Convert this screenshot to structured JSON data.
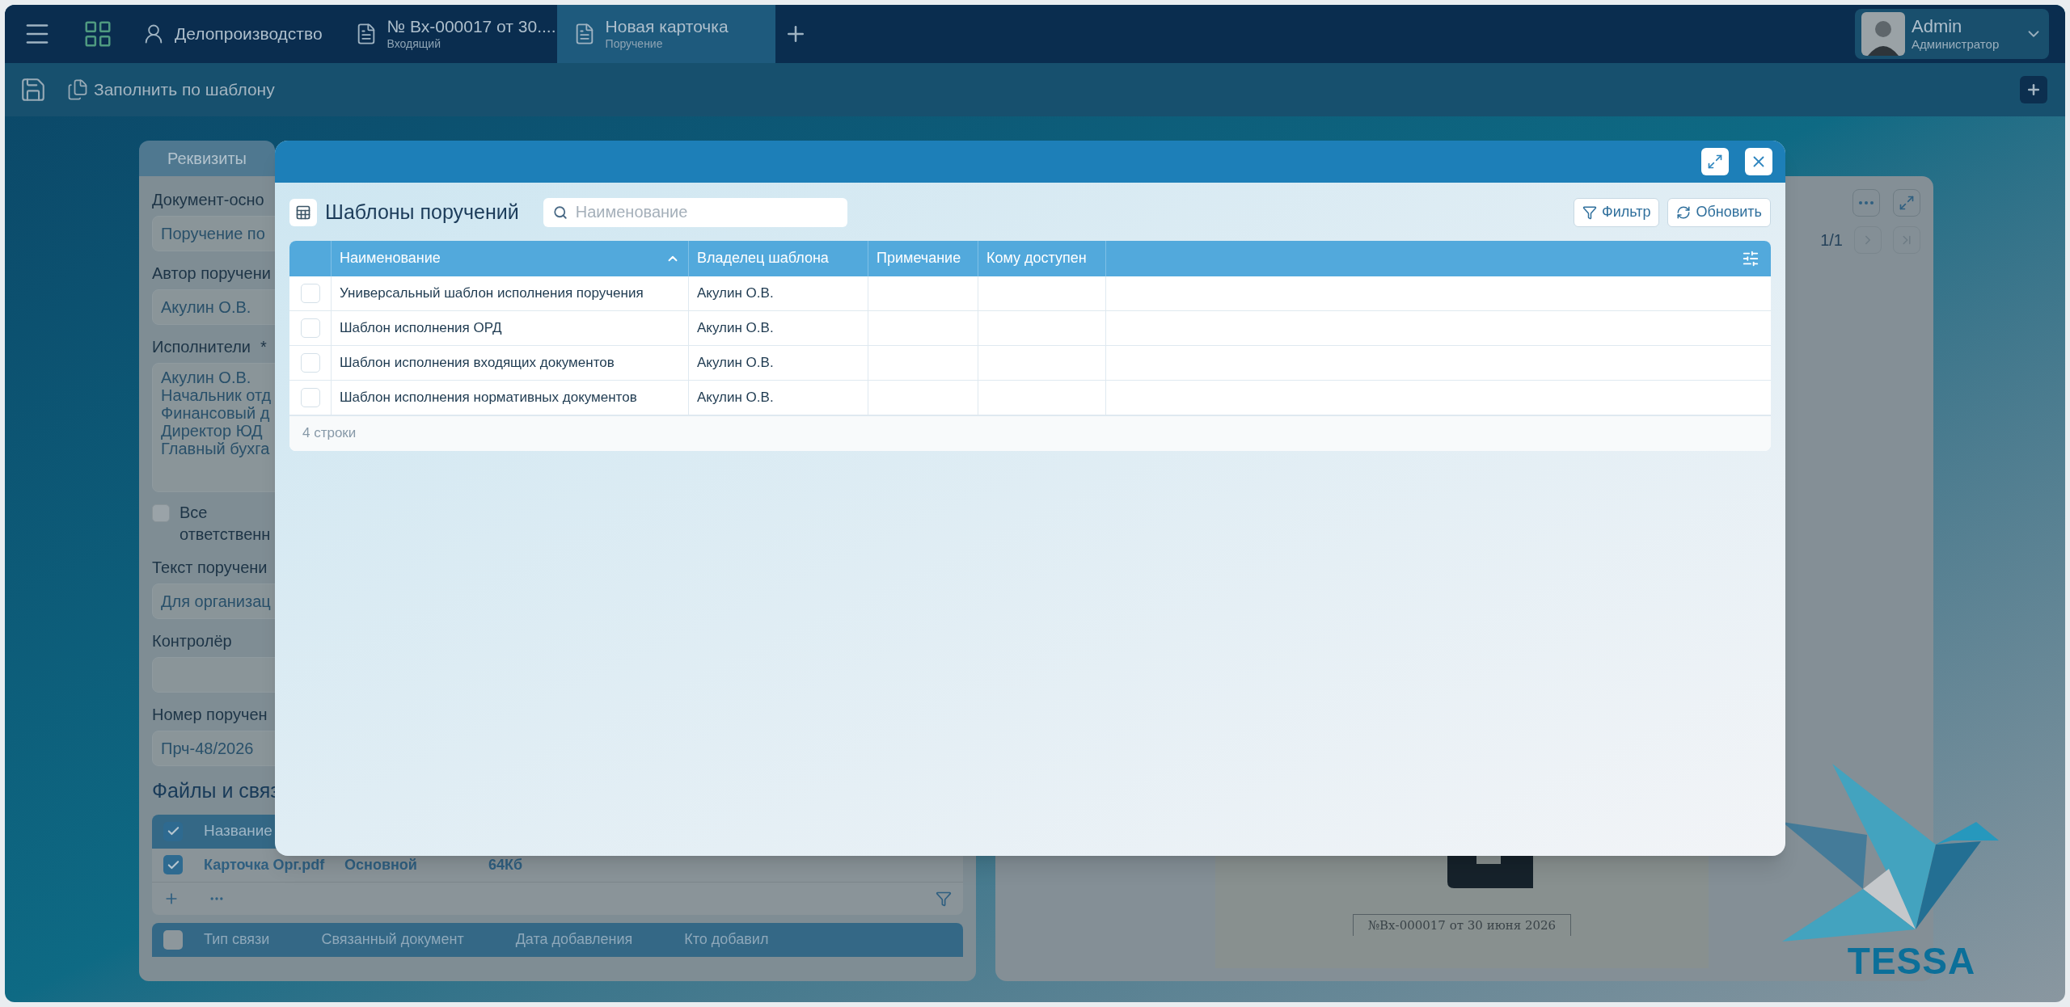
{
  "top_bar": {
    "tabs": [
      {
        "kind": "workplace",
        "title": "Делопроизводство",
        "selected": false
      },
      {
        "kind": "card",
        "title": "№ Вх-000017 от 30....",
        "subtitle": "Входящий",
        "selected": false
      },
      {
        "kind": "card",
        "title": "Новая карточка",
        "subtitle": "Поручение",
        "selected": true
      }
    ],
    "user": {
      "name": "Admin",
      "role": "Администратор"
    }
  },
  "toolbar": {
    "fill_button": "Заполнить по шаблону"
  },
  "card": {
    "tabs": [
      {
        "label": "Реквизиты",
        "selected": true
      }
    ],
    "fields": [
      {
        "kind": "text",
        "label": "Документ-осно",
        "value": "Поручение по"
      },
      {
        "kind": "text",
        "label": "Автор поручени",
        "value": "Акулин О.В."
      },
      {
        "kind": "multiline",
        "label": "Исполнители",
        "required_mark": "*",
        "lines": [
          "Акулин О.В.",
          "Начальник отд",
          "Финансовый д",
          "Директор ЮД",
          "Главный бухга"
        ]
      },
      {
        "kind": "checkbox",
        "lines": [
          "Все",
          "ответственн"
        ],
        "checked": false
      },
      {
        "kind": "text",
        "label": "Текст поручени",
        "value": "Для организац"
      },
      {
        "kind": "text",
        "label": "Контролёр"
      },
      {
        "kind": "text",
        "label": "Номер поручен",
        "value": "Прч-48/2026"
      }
    ],
    "files": {
      "title": "Файлы и связ",
      "all_checked": true,
      "columns": [
        "Название"
      ],
      "rows": [
        {
          "checked": true,
          "cells": [
            "Карточка Орг.pdf",
            "Основной",
            "64Кб"
          ]
        }
      ]
    },
    "links": {
      "all_checked": false,
      "columns": [
        "Тип связи",
        "Связанный документ",
        "Дата добавления",
        "Кто добавил"
      ]
    }
  },
  "preview": {
    "page_counter": "1/1",
    "stamp": "№Вх-000017 от 30 июня 2026"
  },
  "dialog": {
    "title": "Шаблоны поручений",
    "search": {
      "placeholder": "Наименование"
    },
    "filter_button": "Фильтр",
    "refresh_button": "Обновить",
    "table": {
      "columns": [
        {
          "label": "Наименование",
          "sorted": true
        },
        {
          "label": "Владелец шаблона",
          "sorted": false
        },
        {
          "label": "Примечание",
          "sorted": false
        },
        {
          "label": "Кому доступен",
          "sorted": false
        }
      ],
      "rows": [
        {
          "selected": false,
          "cells": [
            "Универсальный шаблон исполнения поручения",
            "Акулин О.В."
          ]
        },
        {
          "selected": false,
          "cells": [
            "Шаблон исполнения ОРД",
            "Акулин О.В."
          ]
        },
        {
          "selected": false,
          "cells": [
            "Шаблон исполнения входящих документов",
            "Акулин О.В."
          ]
        },
        {
          "selected": false,
          "cells": [
            "Шаблон исполнения нормативных документов",
            "Акулин О.В."
          ]
        }
      ]
    },
    "footer": "4 строки"
  },
  "logo": "TESSA"
}
